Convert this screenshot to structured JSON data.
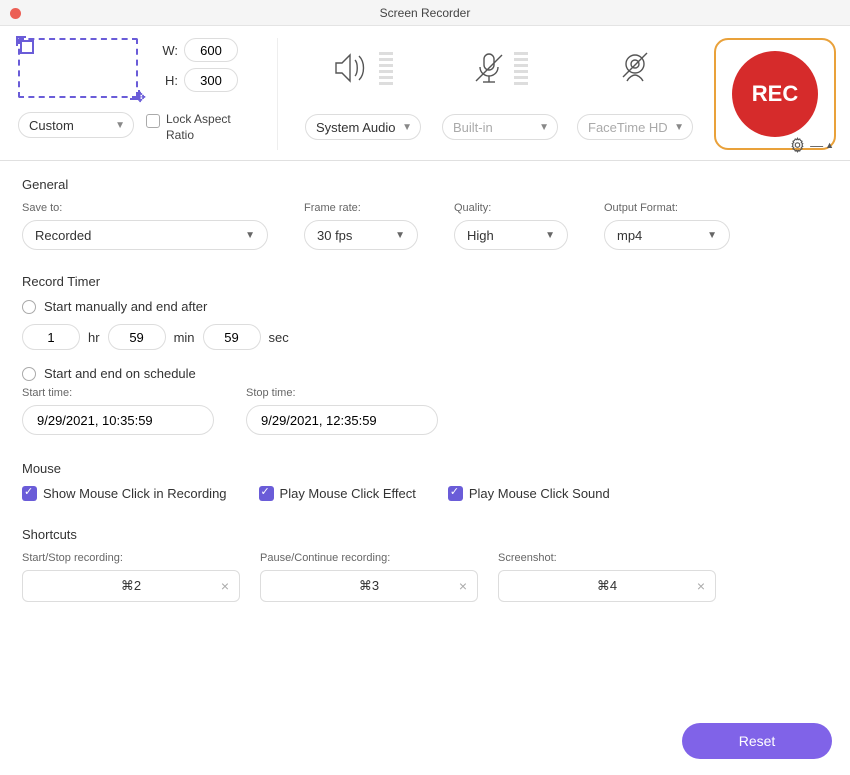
{
  "title": "Screen Recorder",
  "region": {
    "w_label": "W:",
    "h_label": "H:",
    "w": "600",
    "h": "300",
    "mode": "Custom",
    "lock_label": "Lock Aspect Ratio"
  },
  "audio_select": "System Audio",
  "mic_select": "Built-in",
  "cam_select": "FaceTime HD",
  "rec_label": "REC",
  "general": {
    "header": "General",
    "save_to_label": "Save to:",
    "save_to": "Recorded",
    "frame_rate_label": "Frame rate:",
    "frame_rate": "30 fps",
    "quality_label": "Quality:",
    "quality": "High",
    "format_label": "Output Format:",
    "format": "mp4"
  },
  "timer": {
    "header": "Record Timer",
    "opt1": "Start manually and end after",
    "hr": "1",
    "hr_u": "hr",
    "min": "59",
    "min_u": "min",
    "sec": "59",
    "sec_u": "sec",
    "opt2": "Start and end on schedule",
    "start_label": "Start time:",
    "stop_label": "Stop time:",
    "start_val": "9/29/2021, 10:35:59",
    "stop_val": "9/29/2021, 12:35:59"
  },
  "mouse": {
    "header": "Mouse",
    "c1": "Show Mouse Click in Recording",
    "c2": "Play Mouse Click Effect",
    "c3": "Play Mouse Click Sound"
  },
  "shortcuts": {
    "header": "Shortcuts",
    "s1_label": "Start/Stop recording:",
    "s2_label": "Pause/Continue recording:",
    "s3_label": "Screenshot:",
    "s1": "⌘2",
    "s2": "⌘3",
    "s3": "⌘4"
  },
  "reset": "Reset"
}
